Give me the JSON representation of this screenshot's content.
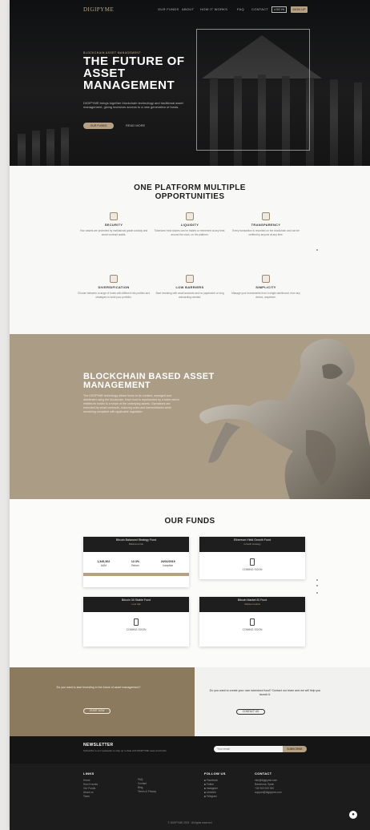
{
  "nav": {
    "logo": "DIGIPYME",
    "links": [
      "OUR FUNDS",
      "ABOUT",
      "HOW IT WORKS",
      "FAQ",
      "CONTACT"
    ],
    "login": "LOG IN",
    "signup": "SIGN UP"
  },
  "hero": {
    "eyebrow": "BLOCKCHAIN ASSET MANAGEMENT",
    "title": "THE FUTURE OF ASSET MANAGEMENT",
    "description": "DIGIPYME brings together blockchain technology and traditional asset management, giving investors access to a new generation of funds.",
    "cta": "OUR FUNDS",
    "secondary": "READ MORE"
  },
  "platform": {
    "title": "ONE PLATFORM MULTIPLE OPPORTUNITIES",
    "features": [
      {
        "title": "SECURITY",
        "text": "Your assets are protected by institutional grade custody and smart contract audits."
      },
      {
        "title": "LIQUIDITY",
        "text": "Tokenized fund shares can be traded or redeemed at any time, around the clock, on the platform."
      },
      {
        "title": "TRANSPARENCY",
        "text": "Every transaction is recorded on the blockchain and can be verified by anyone at any time."
      },
      {
        "title": "DIVERSIFICATION",
        "text": "Choose between a range of funds with different risk profiles and strategies to build your portfolio."
      },
      {
        "title": "LOW BARRIERS",
        "text": "Start investing with small amounts and no paperwork or long onboarding needed."
      },
      {
        "title": "SIMPLICITY",
        "text": "Manage your investments from a single dashboard, from any device, anywhere."
      }
    ]
  },
  "blockchain": {
    "title": "BLOCKCHAIN BASED ASSET MANAGEMENT",
    "text": "The DIGIPYME technology allows funds to be created, managed and distributed using the blockchain. Each fund is represented by a token which entitles its holder to a share of the underlying assets. Operations are executed by smart contracts, reducing costs and intermediaries while remaining compliant with applicable regulation."
  },
  "funds": {
    "title": "OUR FUNDS",
    "cards": [
      {
        "name": "Bitcoin Balanced Strategy Fund",
        "sub": "Balanced risk",
        "stats": [
          {
            "v": "1,345,302",
            "l": "AUM"
          },
          {
            "v": "12.3%",
            "l": "Return"
          },
          {
            "v": "23/02/2019",
            "l": "Inception"
          }
        ],
        "status": ""
      },
      {
        "name": "Ethereum Yield Growth Fund",
        "sub": "Growth strategy",
        "stats": [],
        "status": "COMING SOON"
      },
      {
        "name": "Bitcoin 30 Stable Fund",
        "sub": "Low risk",
        "stats": [],
        "status": "COMING SOON"
      },
      {
        "name": "Bitcoin Market ID Fund",
        "sub": "Market neutral",
        "stats": [],
        "status": "COMING SOON"
      }
    ]
  },
  "cta_left": {
    "text": "Do you want to start investing in the future of asset management?",
    "button": "START NOW"
  },
  "cta_right": {
    "text": "Do you want to create your own tokenized fund? Contact our team and we will help you launch it.",
    "button": "CONTACT US"
  },
  "newsletter": {
    "title": "NEWSLETTER",
    "text": "Subscribe to our newsletter to stay up to date with DIGIPYME news and funds.",
    "placeholder": "Your email",
    "button": "SUBSCRIBE"
  },
  "footer": {
    "links_title": "LINKS",
    "links_a": [
      "Home",
      "How it works",
      "Our Funds",
      "About us",
      "Team"
    ],
    "links_b": [
      "FAQ",
      "Contact",
      "Blog",
      "Terms & Privacy"
    ],
    "follow_title": "FOLLOW US",
    "follow": [
      "Facebook",
      "Twitter",
      "Instagram",
      "LinkedIn",
      "Telegram"
    ],
    "contact_title": "CONTACT",
    "contact": [
      "info@digipyme.com",
      "Barcelona, Spain",
      "+34 900 000 000",
      "support@digipyme.com"
    ],
    "copyright": "© DIGIPYME 2019 · All rights reserved"
  },
  "colors": {
    "accent": "#b6a183",
    "dark": "#1c1c1d",
    "taupe": "#ab9c86"
  }
}
